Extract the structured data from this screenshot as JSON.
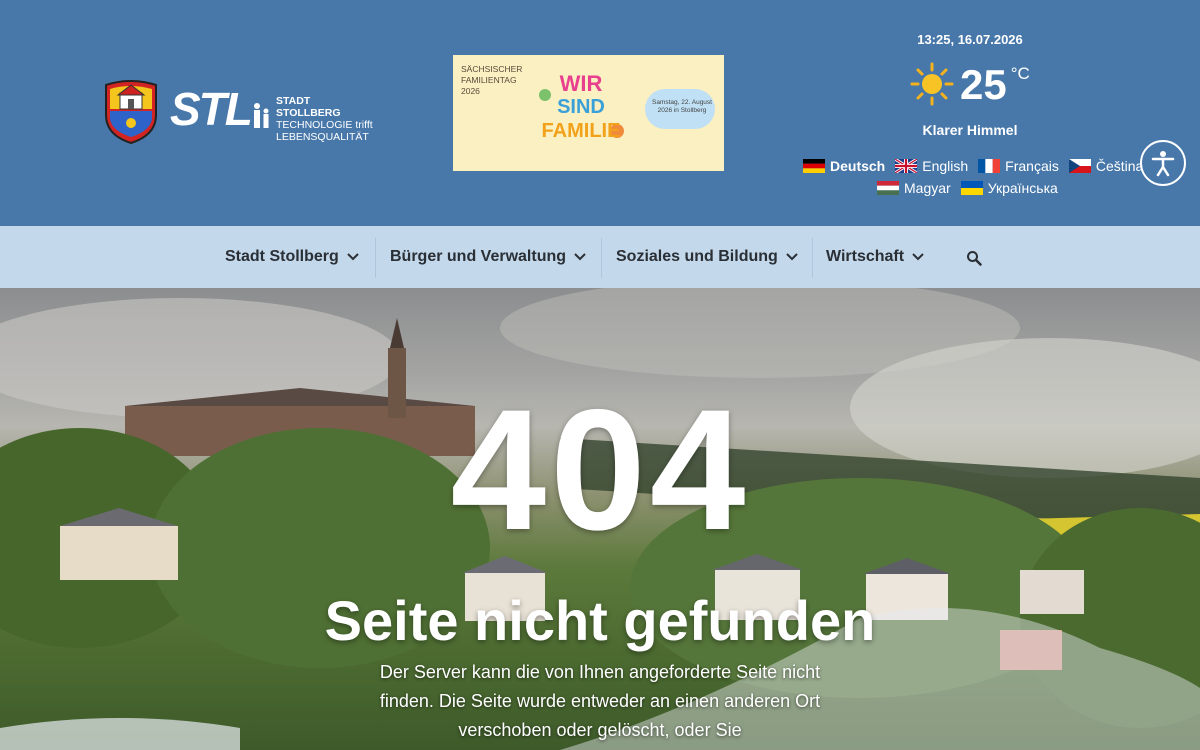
{
  "header": {
    "logo": {
      "letters": "STL",
      "line1": "STADT STOLLBERG",
      "line2": "TECHNOLOGIE trifft",
      "line3": "LEBENSQUALITÄT"
    },
    "banner": {
      "title_lines": [
        "SÄCHSISCHER",
        "FAMILIENTAG",
        "2026"
      ],
      "slogan": "WIR SIND FAMILIE",
      "event": "Samstag, 22. August 2026 in Stollberg"
    },
    "datetime": "13:25, 16.07.2026",
    "weather": {
      "temp": "25",
      "unit": "°C",
      "condition": "Klarer Himmel",
      "icon": "sun-icon"
    },
    "languages": [
      {
        "label": "Deutsch",
        "active": true
      },
      {
        "label": "English"
      },
      {
        "label": "Français"
      },
      {
        "label": "Čeština"
      },
      {
        "label": "Magyar"
      },
      {
        "label": "Українська"
      }
    ]
  },
  "nav": {
    "items": [
      "Stadt Stollberg",
      "Bürger und Verwaltung",
      "Soziales und Bildung",
      "Wirtschaft"
    ]
  },
  "error": {
    "code": "404",
    "title": "Seite nicht gefunden",
    "description": "Der Server kann die von Ihnen angeforderte Seite nicht finden. Die Seite wurde entweder an einen anderen Ort verschoben oder gelöscht, oder Sie"
  },
  "colors": {
    "header": "#4878aa",
    "nav": "#c3d8ea",
    "text_dark": "#2a2f36"
  }
}
